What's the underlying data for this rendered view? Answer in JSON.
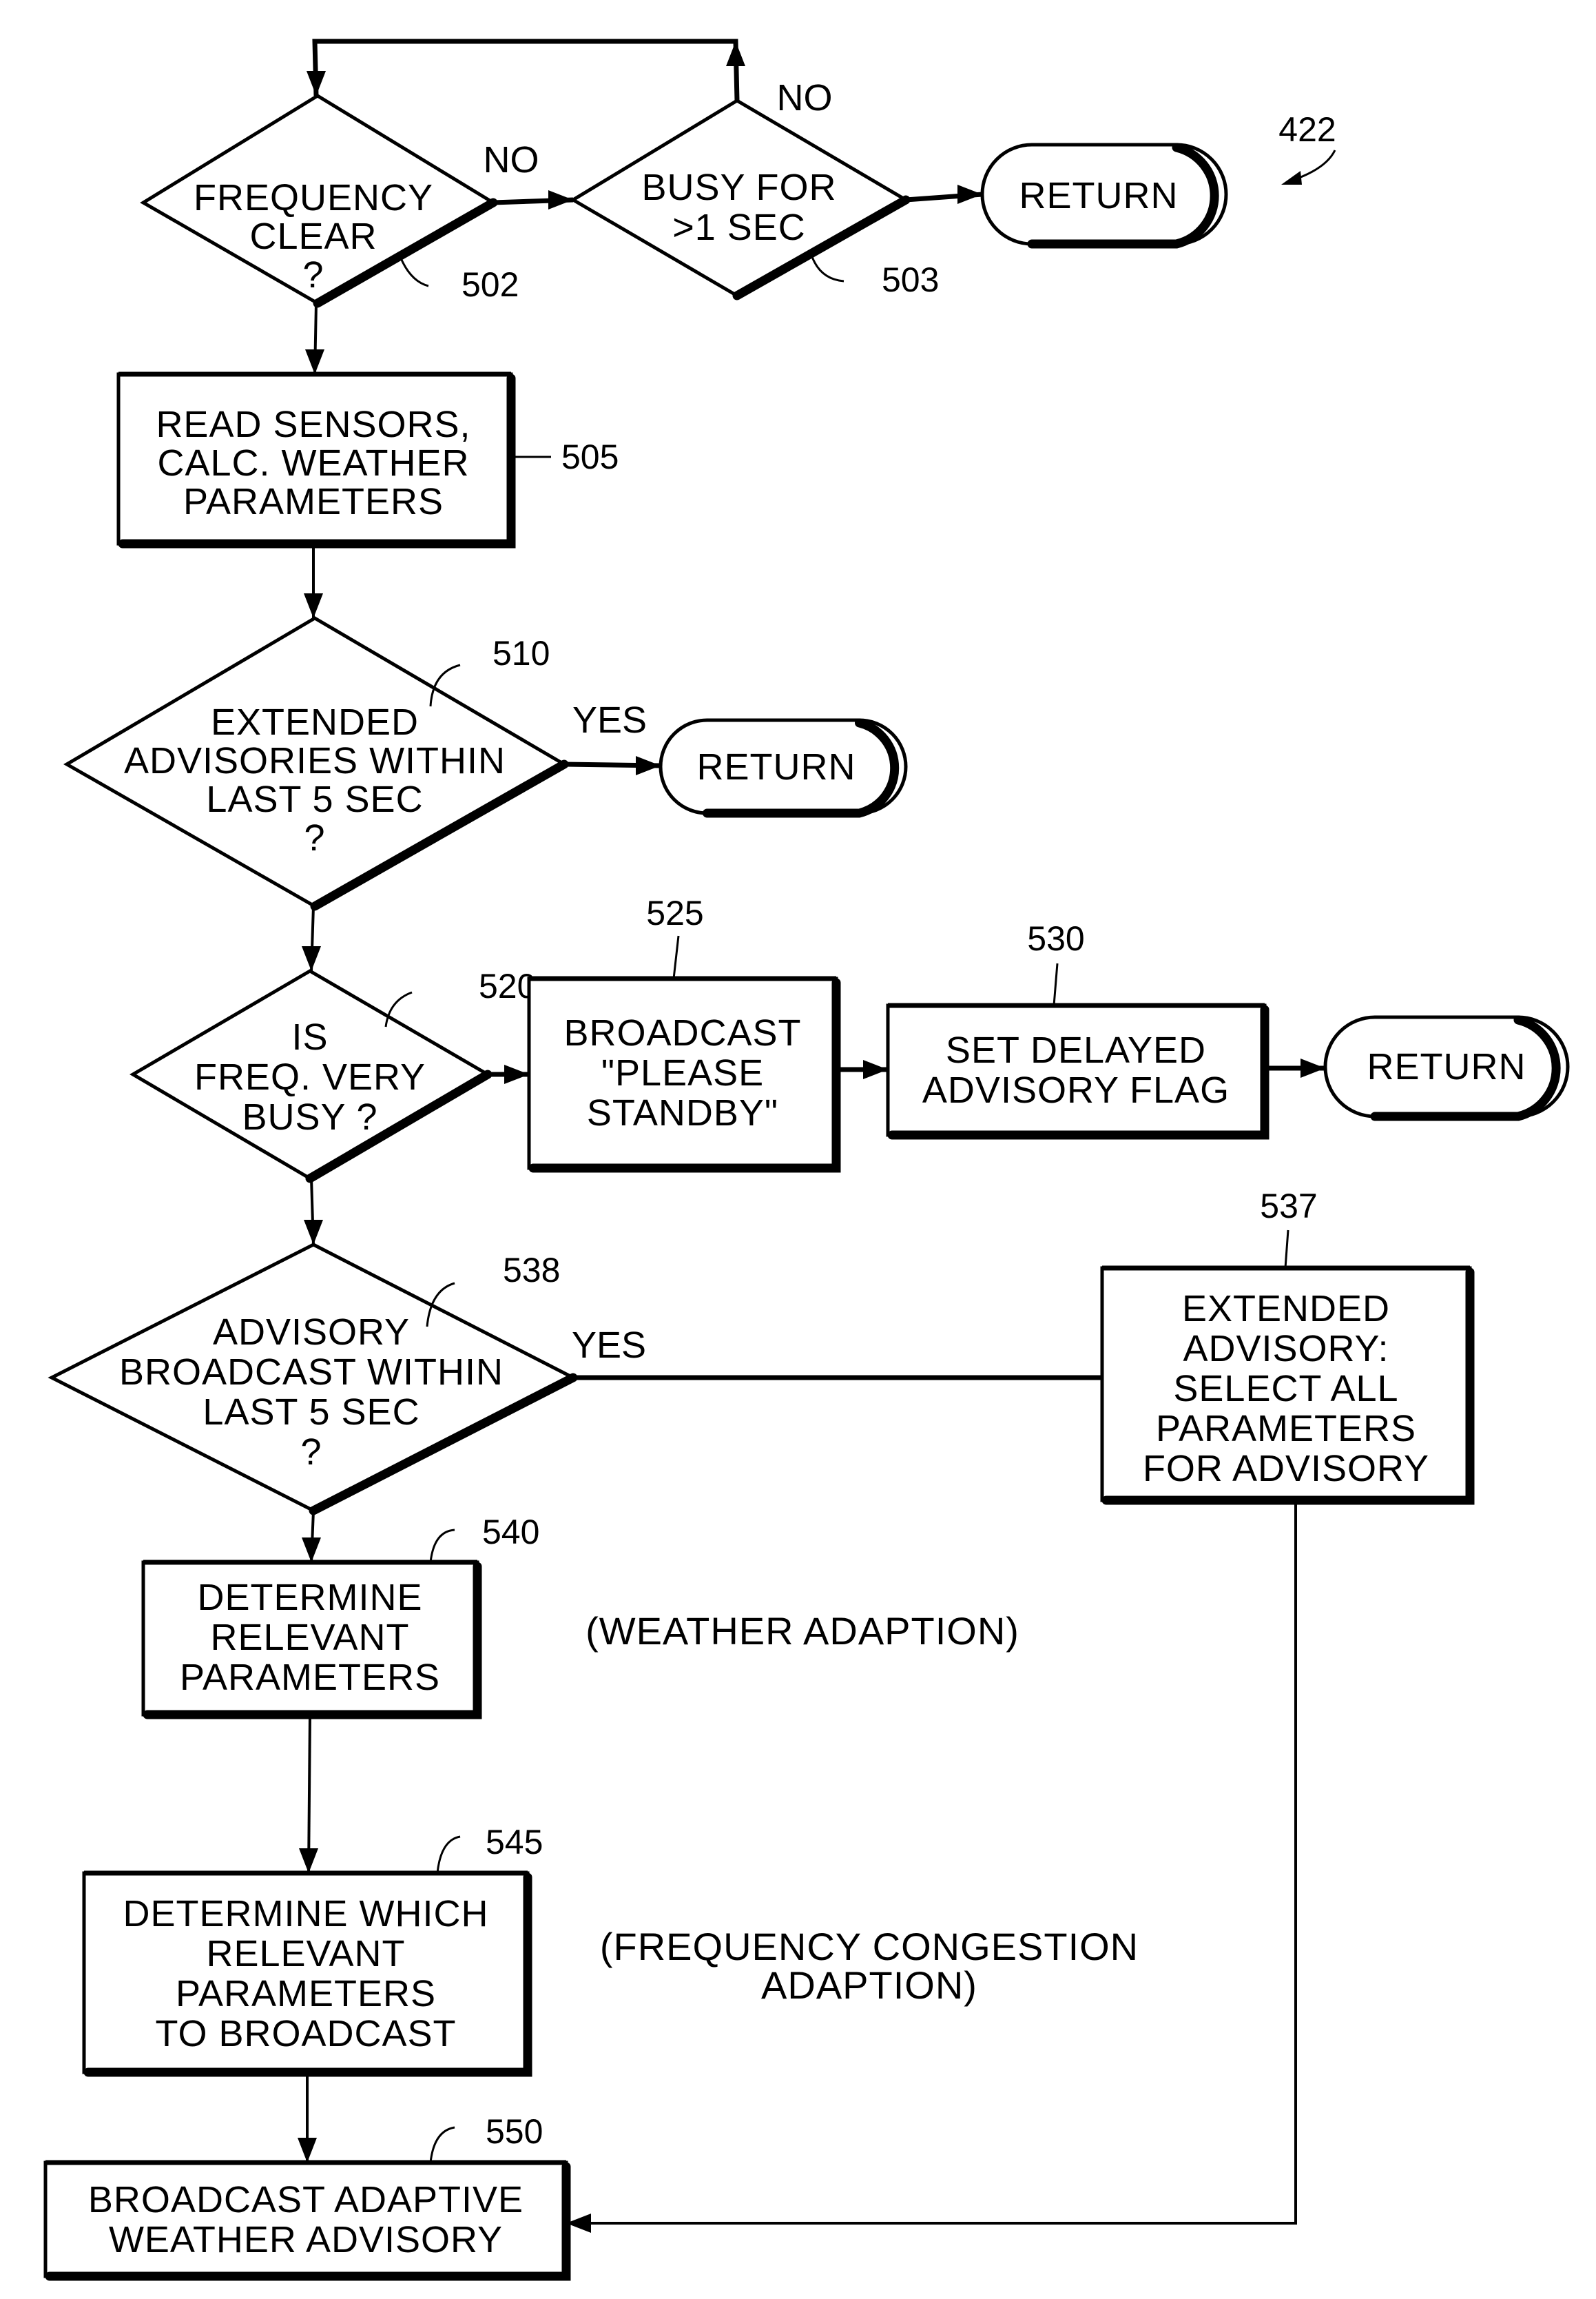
{
  "figure": {
    "reference": "422",
    "accent_color": "#000000",
    "background_color": "#ffffff"
  },
  "nodes": {
    "n502": {
      "ref": "502",
      "type": "decision",
      "lines": [
        "FREQUENCY",
        "CLEAR",
        "?"
      ]
    },
    "n503": {
      "ref": "503",
      "type": "decision",
      "lines": [
        "BUSY FOR",
        ">1 SEC"
      ]
    },
    "r1": {
      "type": "terminal",
      "lines": [
        "RETURN"
      ]
    },
    "n505": {
      "ref": "505",
      "type": "process",
      "lines": [
        "READ SENSORS,",
        "CALC. WEATHER",
        "PARAMETERS"
      ]
    },
    "n510": {
      "ref": "510",
      "type": "decision",
      "lines": [
        "EXTENDED",
        "ADVISORIES WITHIN",
        "LAST 5 SEC",
        "?"
      ]
    },
    "r2": {
      "type": "terminal",
      "lines": [
        "RETURN"
      ]
    },
    "n520": {
      "ref": "520",
      "type": "decision",
      "lines": [
        "IS",
        "FREQ. VERY",
        "BUSY ?"
      ]
    },
    "n525": {
      "ref": "525",
      "type": "process",
      "lines": [
        "BROADCAST",
        "\"PLEASE",
        "STANDBY\""
      ]
    },
    "n530": {
      "ref": "530",
      "type": "process",
      "lines": [
        "SET DELAYED",
        "ADVISORY FLAG"
      ]
    },
    "r3": {
      "type": "terminal",
      "lines": [
        "RETURN"
      ]
    },
    "n538": {
      "ref": "538",
      "type": "decision",
      "lines": [
        "ADVISORY",
        "BROADCAST WITHIN",
        "LAST 5 SEC",
        "?"
      ]
    },
    "n537": {
      "ref": "537",
      "type": "process",
      "lines": [
        "EXTENDED",
        "ADVISORY:",
        "SELECT ALL",
        "PARAMETERS",
        "FOR ADVISORY"
      ]
    },
    "n540": {
      "ref": "540",
      "type": "process",
      "lines": [
        "DETERMINE",
        "RELEVANT",
        "PARAMETERS"
      ]
    },
    "n545": {
      "ref": "545",
      "type": "process",
      "lines": [
        "DETERMINE WHICH",
        "RELEVANT",
        "PARAMETERS",
        "TO BROADCAST"
      ]
    },
    "n550": {
      "ref": "550",
      "type": "process",
      "lines": [
        "BROADCAST ADAPTIVE",
        "WEATHER ADVISORY"
      ]
    }
  },
  "branch_labels": {
    "b502_no": "NO",
    "b503_no": "NO",
    "b510_yes": "YES",
    "b538_yes": "YES"
  },
  "annotations": {
    "weather": [
      "(WEATHER ADAPTION)"
    ],
    "congestion": [
      "(FREQUENCY CONGESTION",
      "ADAPTION)"
    ]
  },
  "edges": [
    {
      "from": "n502",
      "to": "n503",
      "label": "NO"
    },
    {
      "from": "n503",
      "to": "n502",
      "label": "NO"
    },
    {
      "from": "n503",
      "to": "r1"
    },
    {
      "from": "n502",
      "to": "n505"
    },
    {
      "from": "n505",
      "to": "n510"
    },
    {
      "from": "n510",
      "to": "r2",
      "label": "YES"
    },
    {
      "from": "n510",
      "to": "n520"
    },
    {
      "from": "n520",
      "to": "n525"
    },
    {
      "from": "n525",
      "to": "n530"
    },
    {
      "from": "n530",
      "to": "r3"
    },
    {
      "from": "n520",
      "to": "n538"
    },
    {
      "from": "n538",
      "to": "n537",
      "label": "YES"
    },
    {
      "from": "n538",
      "to": "n540"
    },
    {
      "from": "n540",
      "to": "n545"
    },
    {
      "from": "n545",
      "to": "n550"
    },
    {
      "from": "n537",
      "to": "n550"
    }
  ]
}
